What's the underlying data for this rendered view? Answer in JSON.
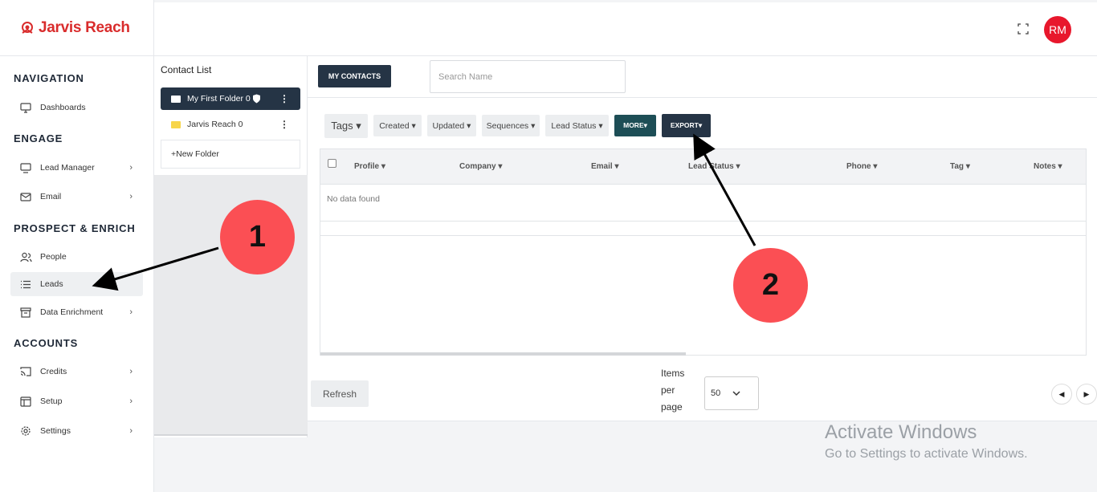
{
  "app": {
    "logo_text": "Jarvis Reach",
    "brand_color": "#d92c2c",
    "accent_dark": "#253445"
  },
  "header": {
    "fullscreen_icon": "expand-icon",
    "avatar_initials": "RM",
    "avatar_color": "#e8172c"
  },
  "sidebar": {
    "sections": [
      "NAVIGATION",
      "ENGAGE",
      "PROSPECT & ENRICH",
      "ACCOUNTS"
    ],
    "items": [
      {
        "label": "Dashboards",
        "icon": "monitor-icon"
      },
      {
        "label": "Lead Manager",
        "icon": "desktop-icon",
        "chevron": "›"
      },
      {
        "label": "Email",
        "icon": "mail-icon",
        "chevron": "›"
      },
      {
        "label": "People",
        "icon": "users-icon"
      },
      {
        "label": "Leads",
        "icon": "list-icon"
      },
      {
        "label": "Data Enrichment",
        "icon": "archive-icon",
        "chevron": "›"
      },
      {
        "label": "Credits",
        "icon": "cast-icon",
        "chevron": "›"
      },
      {
        "label": "Setup",
        "icon": "layout-icon",
        "chevron": "›"
      },
      {
        "label": "Settings",
        "icon": "gear-icon",
        "chevron": "›"
      }
    ]
  },
  "contact_list": {
    "title": "Contact List",
    "folders": [
      {
        "label": "My First Folder 0"
      },
      {
        "label": "Jarvis Reach 0"
      }
    ],
    "new_folder": "+New Folder"
  },
  "toolbar": {
    "my_contacts": "MY CONTACTS",
    "search_placeholder": "Search Name"
  },
  "filters": [
    "Tags ▾",
    "Created ▾",
    "Updated ▾",
    "Sequences ▾",
    "Lead Status ▾",
    "MORE▾",
    "EXPORT▾"
  ],
  "table": {
    "columns": [
      "Profile ▾",
      "Company ▾",
      "Email ▾",
      "Lead Status ▾",
      "Phone ▾",
      "Tag ▾",
      "Notes ▾"
    ],
    "empty_text": "No data found"
  },
  "footer": {
    "refresh": "Refresh",
    "items_per_page_label": "Items per page",
    "items_per_page_value": "50",
    "prev": "◀",
    "next": "▶"
  },
  "watermark": {
    "line1": "Activate Windows",
    "line2": "Go to Settings to activate Windows."
  },
  "annotations": {
    "marker1": "1",
    "marker2": "2",
    "marker_color": "#fb4f54"
  }
}
